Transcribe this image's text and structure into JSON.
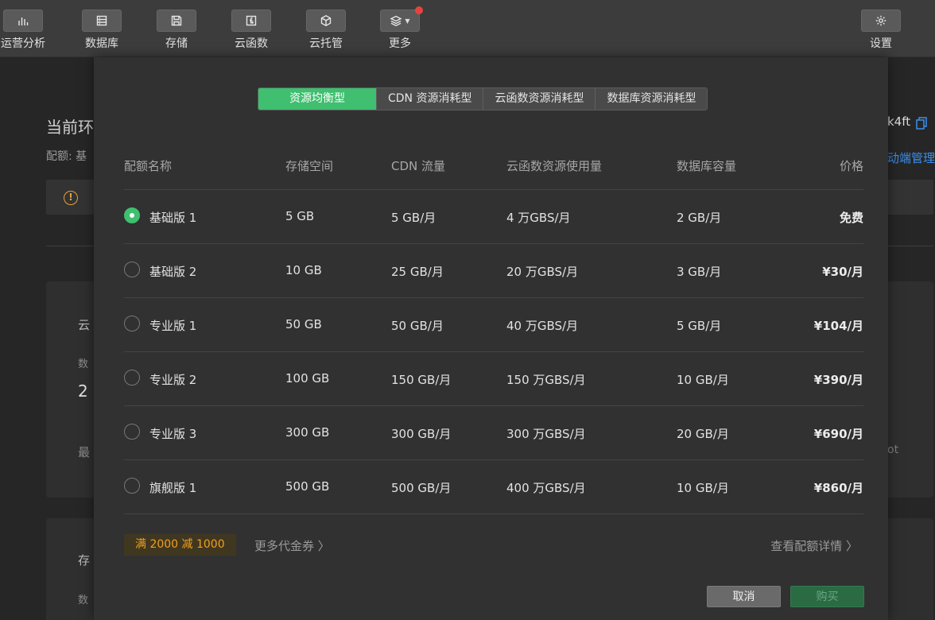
{
  "toolbar": {
    "items": [
      {
        "label": "运营分析",
        "icon": "bar-chart-icon"
      },
      {
        "label": "数据库",
        "icon": "database-icon"
      },
      {
        "label": "存储",
        "icon": "save-icon"
      },
      {
        "label": "云函数",
        "icon": "function-icon"
      },
      {
        "label": "云托管",
        "icon": "cube-icon"
      },
      {
        "label": "更多",
        "icon": "layers-icon"
      }
    ],
    "settings_label": "设置"
  },
  "background": {
    "title": "当前环",
    "quota_prefix": "配额: 基",
    "env_id_suffix": "k4ft",
    "link": "动端管理",
    "card1_title": "云",
    "card1_sub": "数",
    "card1_value": "2",
    "card1_footer": "最",
    "card1_faint": "ot",
    "card2_title": "存",
    "card2_sub": "数"
  },
  "modal": {
    "tabs": [
      "资源均衡型",
      "CDN 资源消耗型",
      "云函数资源消耗型",
      "数据库资源消耗型"
    ],
    "active_tab": 0,
    "columns": {
      "name": "配额名称",
      "storage": "存储空间",
      "cdn": "CDN 流量",
      "fn": "云函数资源使用量",
      "db": "数据库容量",
      "price": "价格"
    },
    "plans": [
      {
        "name": "基础版 1",
        "storage": "5 GB",
        "cdn": "5 GB/月",
        "fn": "4 万GBS/月",
        "db": "2 GB/月",
        "price": "免费",
        "selected": true
      },
      {
        "name": "基础版 2",
        "storage": "10 GB",
        "cdn": "25 GB/月",
        "fn": "20 万GBS/月",
        "db": "3 GB/月",
        "price": "¥30/月",
        "selected": false
      },
      {
        "name": "专业版 1",
        "storage": "50 GB",
        "cdn": "50 GB/月",
        "fn": "40 万GBS/月",
        "db": "5 GB/月",
        "price": "¥104/月",
        "selected": false
      },
      {
        "name": "专业版 2",
        "storage": "100 GB",
        "cdn": "150 GB/月",
        "fn": "150 万GBS/月",
        "db": "10 GB/月",
        "price": "¥390/月",
        "selected": false
      },
      {
        "name": "专业版 3",
        "storage": "300 GB",
        "cdn": "300 GB/月",
        "fn": "300 万GBS/月",
        "db": "20 GB/月",
        "price": "¥690/月",
        "selected": false
      },
      {
        "name": "旗舰版 1",
        "storage": "500 GB",
        "cdn": "500 GB/月",
        "fn": "400 万GBS/月",
        "db": "10 GB/月",
        "price": "¥860/月",
        "selected": false
      }
    ],
    "coupon": "满 2000 减 1000",
    "more_coupons": "更多代金券 〉",
    "quota_details": "查看配额详情 〉",
    "cancel_label": "取消",
    "buy_label": "购买"
  },
  "colors": {
    "accent": "#3fbf6f",
    "coupon_text": "#f0a020",
    "link": "#3b8eed",
    "notification_dot": "#e64340"
  }
}
